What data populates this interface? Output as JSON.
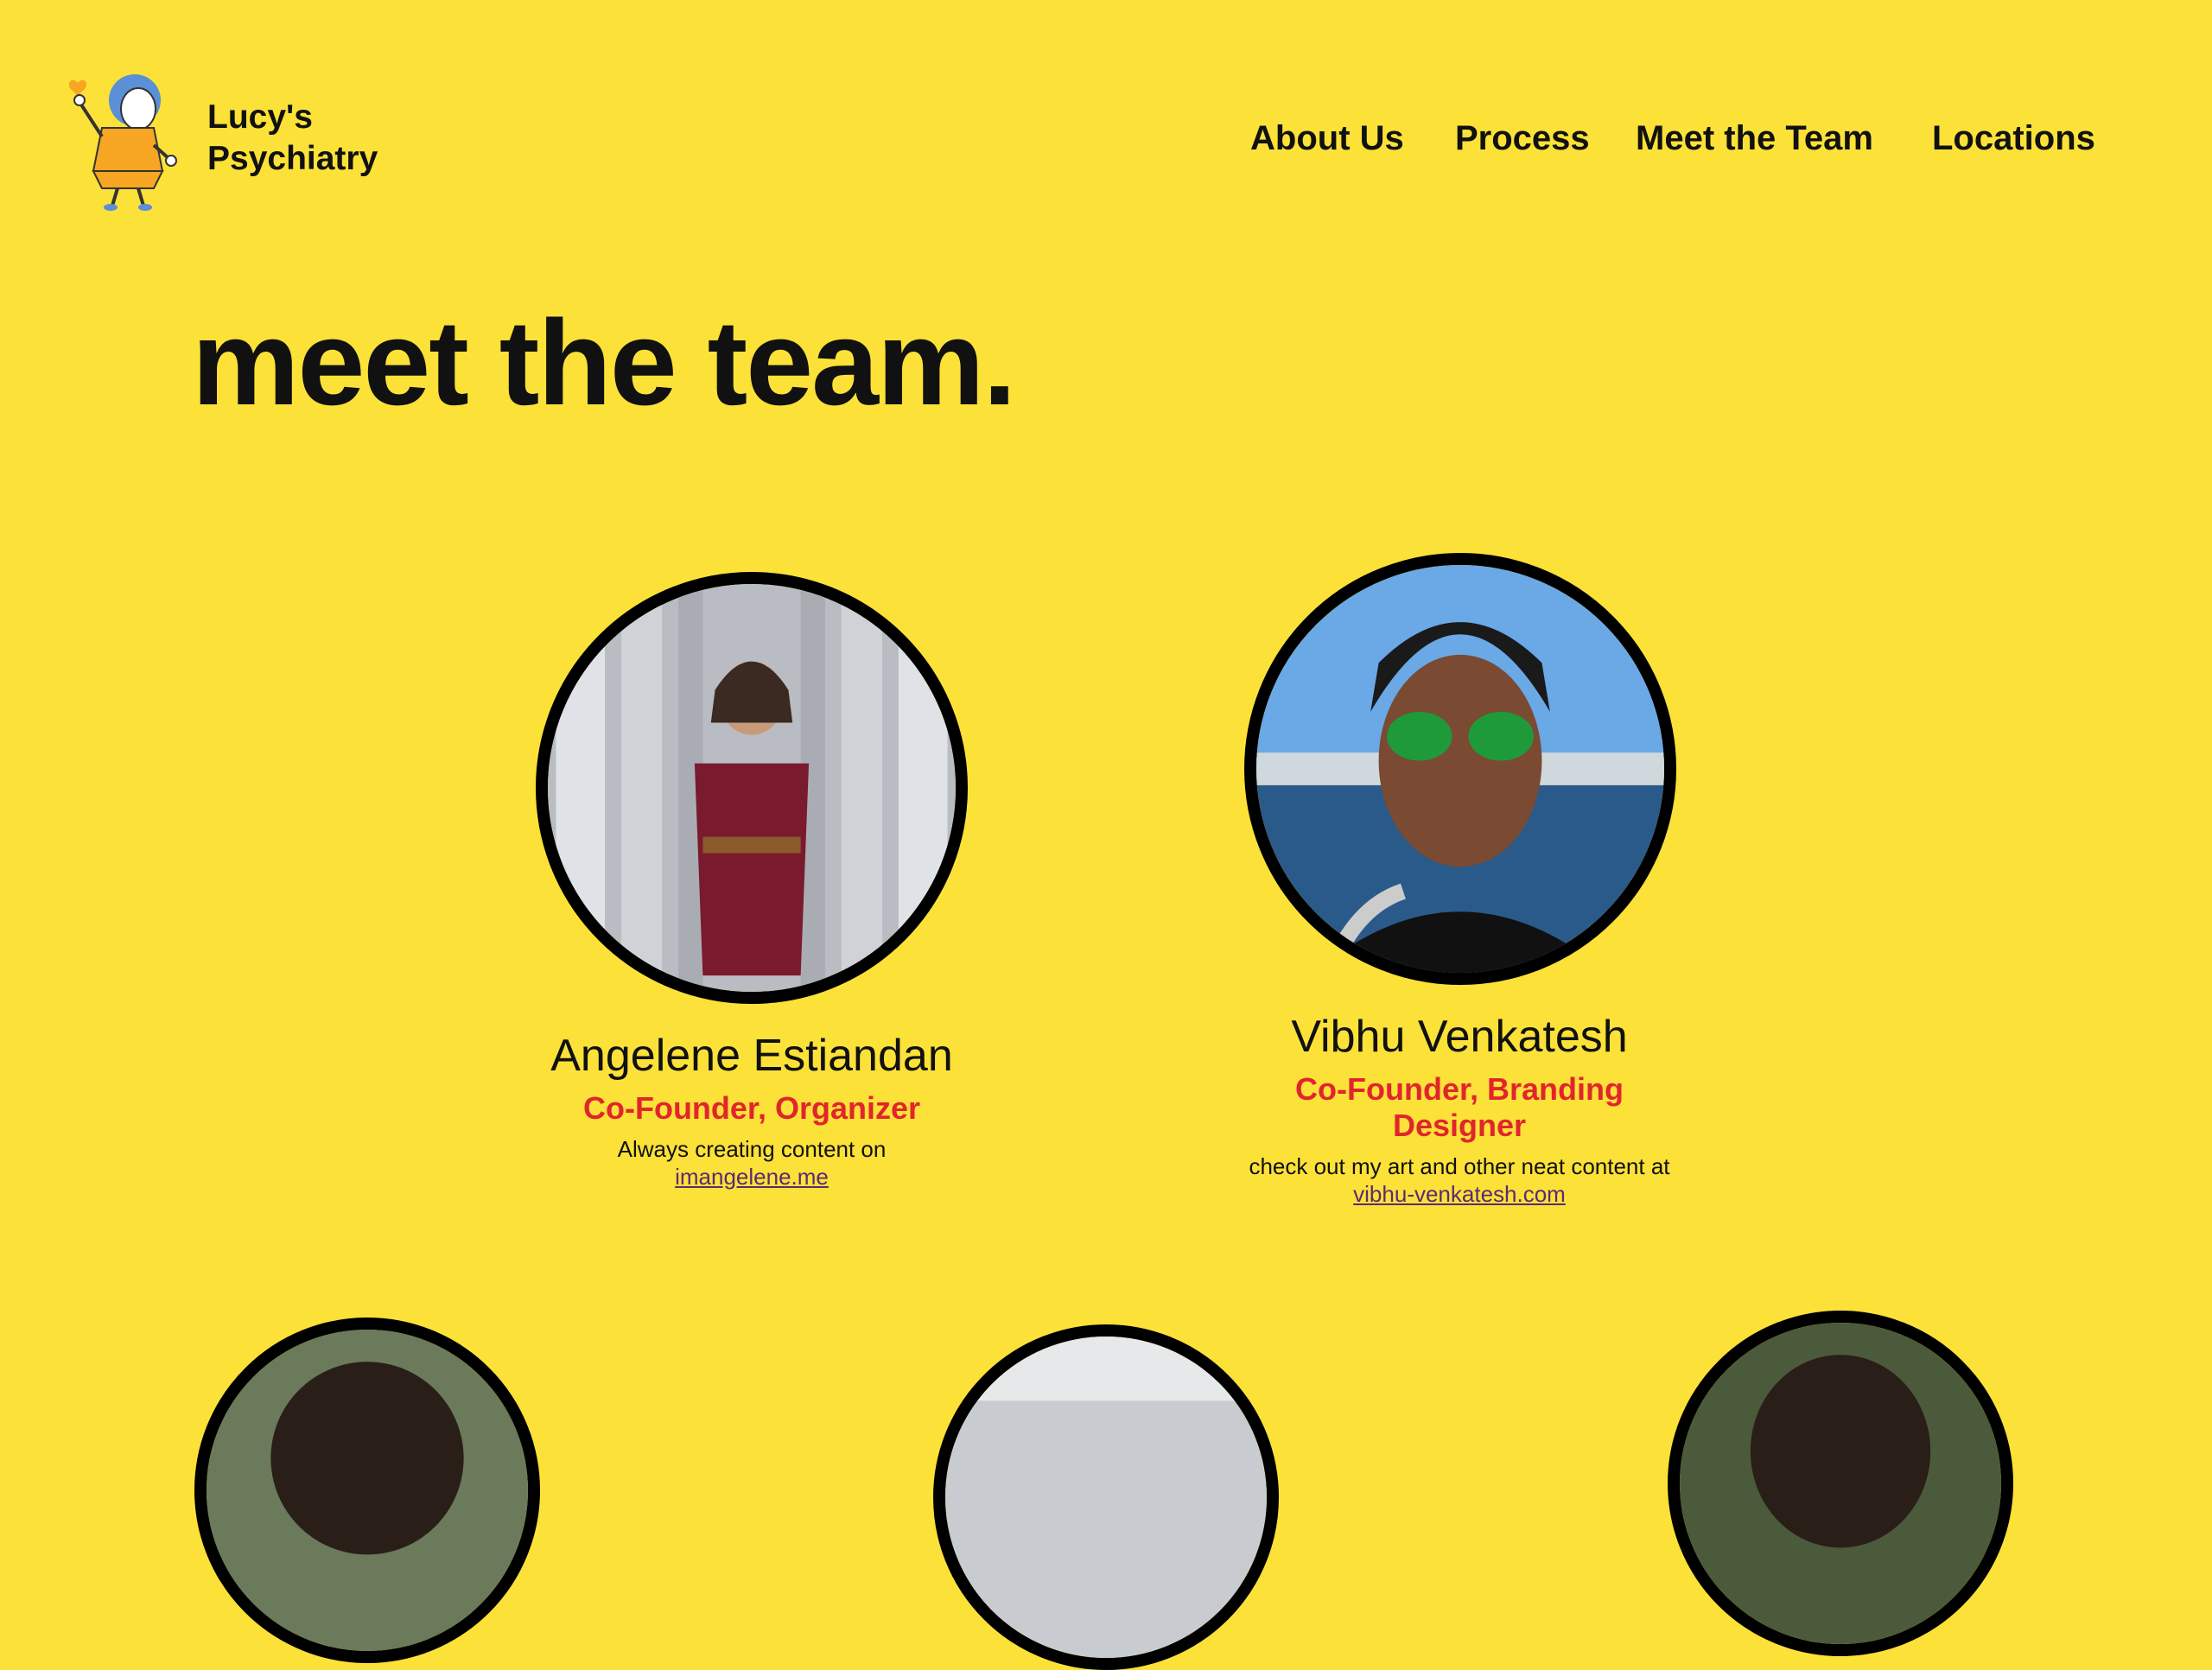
{
  "header": {
    "brand_line1": "Lucy's",
    "brand_line2": "Psychiatry",
    "logo_icon": "lucy-character-logo"
  },
  "nav": [
    {
      "label": "About Us"
    },
    {
      "label": "Process"
    },
    {
      "label": "Meet the Team"
    },
    {
      "label": "Locations"
    }
  ],
  "page": {
    "title": "meet the team."
  },
  "team": [
    {
      "name": "Angelene Estiandan",
      "role": "Co-Founder, Organizer",
      "bio_text": "Always creating content on",
      "bio_link": "imangelene.me"
    },
    {
      "name": "Vibhu Venkatesh",
      "role": "Co-Founder, Branding Designer",
      "bio_text": "check out my art and other neat content at",
      "bio_link": "vibhu-venkatesh.com"
    }
  ],
  "colors": {
    "background": "#fce138",
    "accent_role": "#e1252d",
    "link": "#5a2a74",
    "text": "#111111"
  }
}
